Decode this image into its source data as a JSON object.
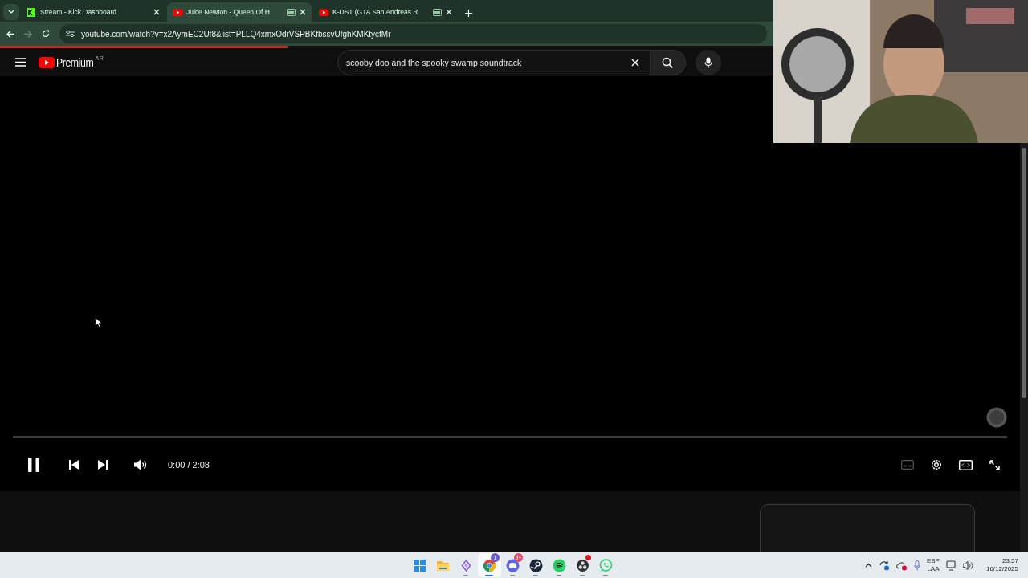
{
  "browser": {
    "tabs": [
      {
        "title": "Stream - Kick Dashboard",
        "kind": "kick",
        "media_icon": false,
        "selected": false
      },
      {
        "title": "Juice Newton - Queen Of H",
        "kind": "youtube",
        "media_icon": true,
        "selected": true
      },
      {
        "title": "K-DST (GTA San Andreas R",
        "kind": "youtube",
        "media_icon": true,
        "selected": false
      }
    ],
    "url": "youtube.com/watch?v=x2AymEC2Uf8&list=PLLQ4xmxOdrVSPBKfbssvUfghKMKtycfMr",
    "load": {
      "level": 0.28
    }
  },
  "youtube": {
    "logo_text": "Premium",
    "country": "AR",
    "search": {
      "value": "scooby doo and the spooky swamp soundtrack"
    },
    "player": {
      "playing": true,
      "progress": {
        "level": 0
      },
      "time": "0:00 / 2:08",
      "captions_enabled": false
    }
  },
  "taskbar": {
    "apps": [
      {
        "kind": "start",
        "active": false,
        "running": false
      },
      {
        "kind": "files",
        "active": false,
        "running": false
      },
      {
        "kind": "diamond",
        "active": false,
        "running": true
      },
      {
        "kind": "chrome",
        "active": true,
        "running": true,
        "badge": "1"
      },
      {
        "kind": "discord",
        "active": false,
        "running": true,
        "badge": "9+"
      },
      {
        "kind": "steam",
        "active": false,
        "running": true
      },
      {
        "kind": "spotify",
        "active": false,
        "running": true
      },
      {
        "kind": "obs",
        "active": false,
        "running": true,
        "dot": true
      },
      {
        "kind": "whatsapp",
        "active": false,
        "running": true
      }
    ],
    "language": [
      "ESP",
      "LAA"
    ],
    "time": "23:57",
    "date": "16/12/2025"
  }
}
